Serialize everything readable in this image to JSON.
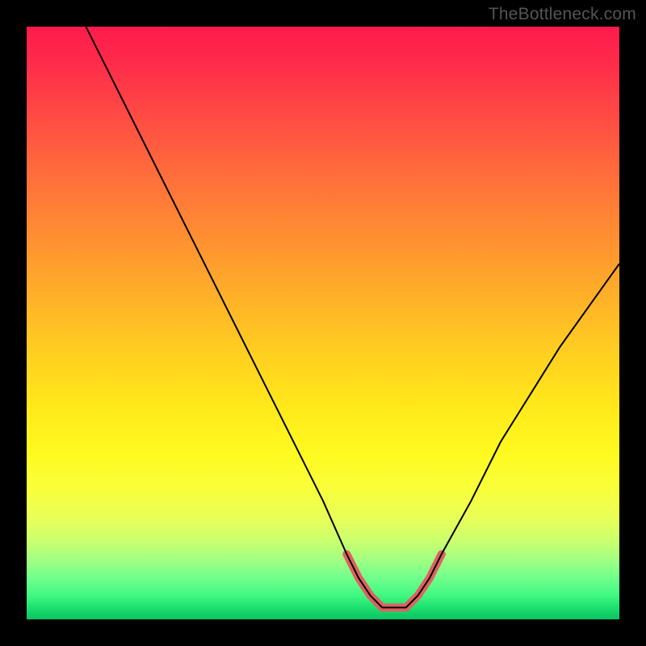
{
  "watermark": "TheBottleneck.com",
  "colors": {
    "frame": "#000000",
    "curve": "#000000",
    "highlight": "#e06060",
    "gradient_top": "#ff1a4d",
    "gradient_bottom": "#0ac260"
  },
  "chart_data": {
    "type": "line",
    "title": "",
    "xlabel": "",
    "ylabel": "",
    "xlim": [
      0,
      100
    ],
    "ylim": [
      0,
      100
    ],
    "grid": false,
    "legend": false,
    "series": [
      {
        "name": "bottleneck-curve",
        "x": [
          10,
          15,
          20,
          25,
          30,
          35,
          40,
          45,
          50,
          54,
          56,
          58,
          60,
          62,
          64,
          66,
          68,
          70,
          75,
          80,
          85,
          90,
          95,
          100
        ],
        "y": [
          100,
          90,
          80,
          70,
          60,
          50,
          40,
          30,
          20,
          11,
          7,
          4,
          2,
          2,
          2,
          4,
          7,
          11,
          20,
          30,
          38,
          46,
          53,
          60
        ]
      }
    ],
    "highlight_region": {
      "name": "optimal-range",
      "x": [
        54,
        56,
        58,
        60,
        62,
        64,
        66,
        68,
        70
      ],
      "y": [
        11,
        7,
        4,
        2,
        2,
        2,
        4,
        7,
        11
      ]
    }
  }
}
